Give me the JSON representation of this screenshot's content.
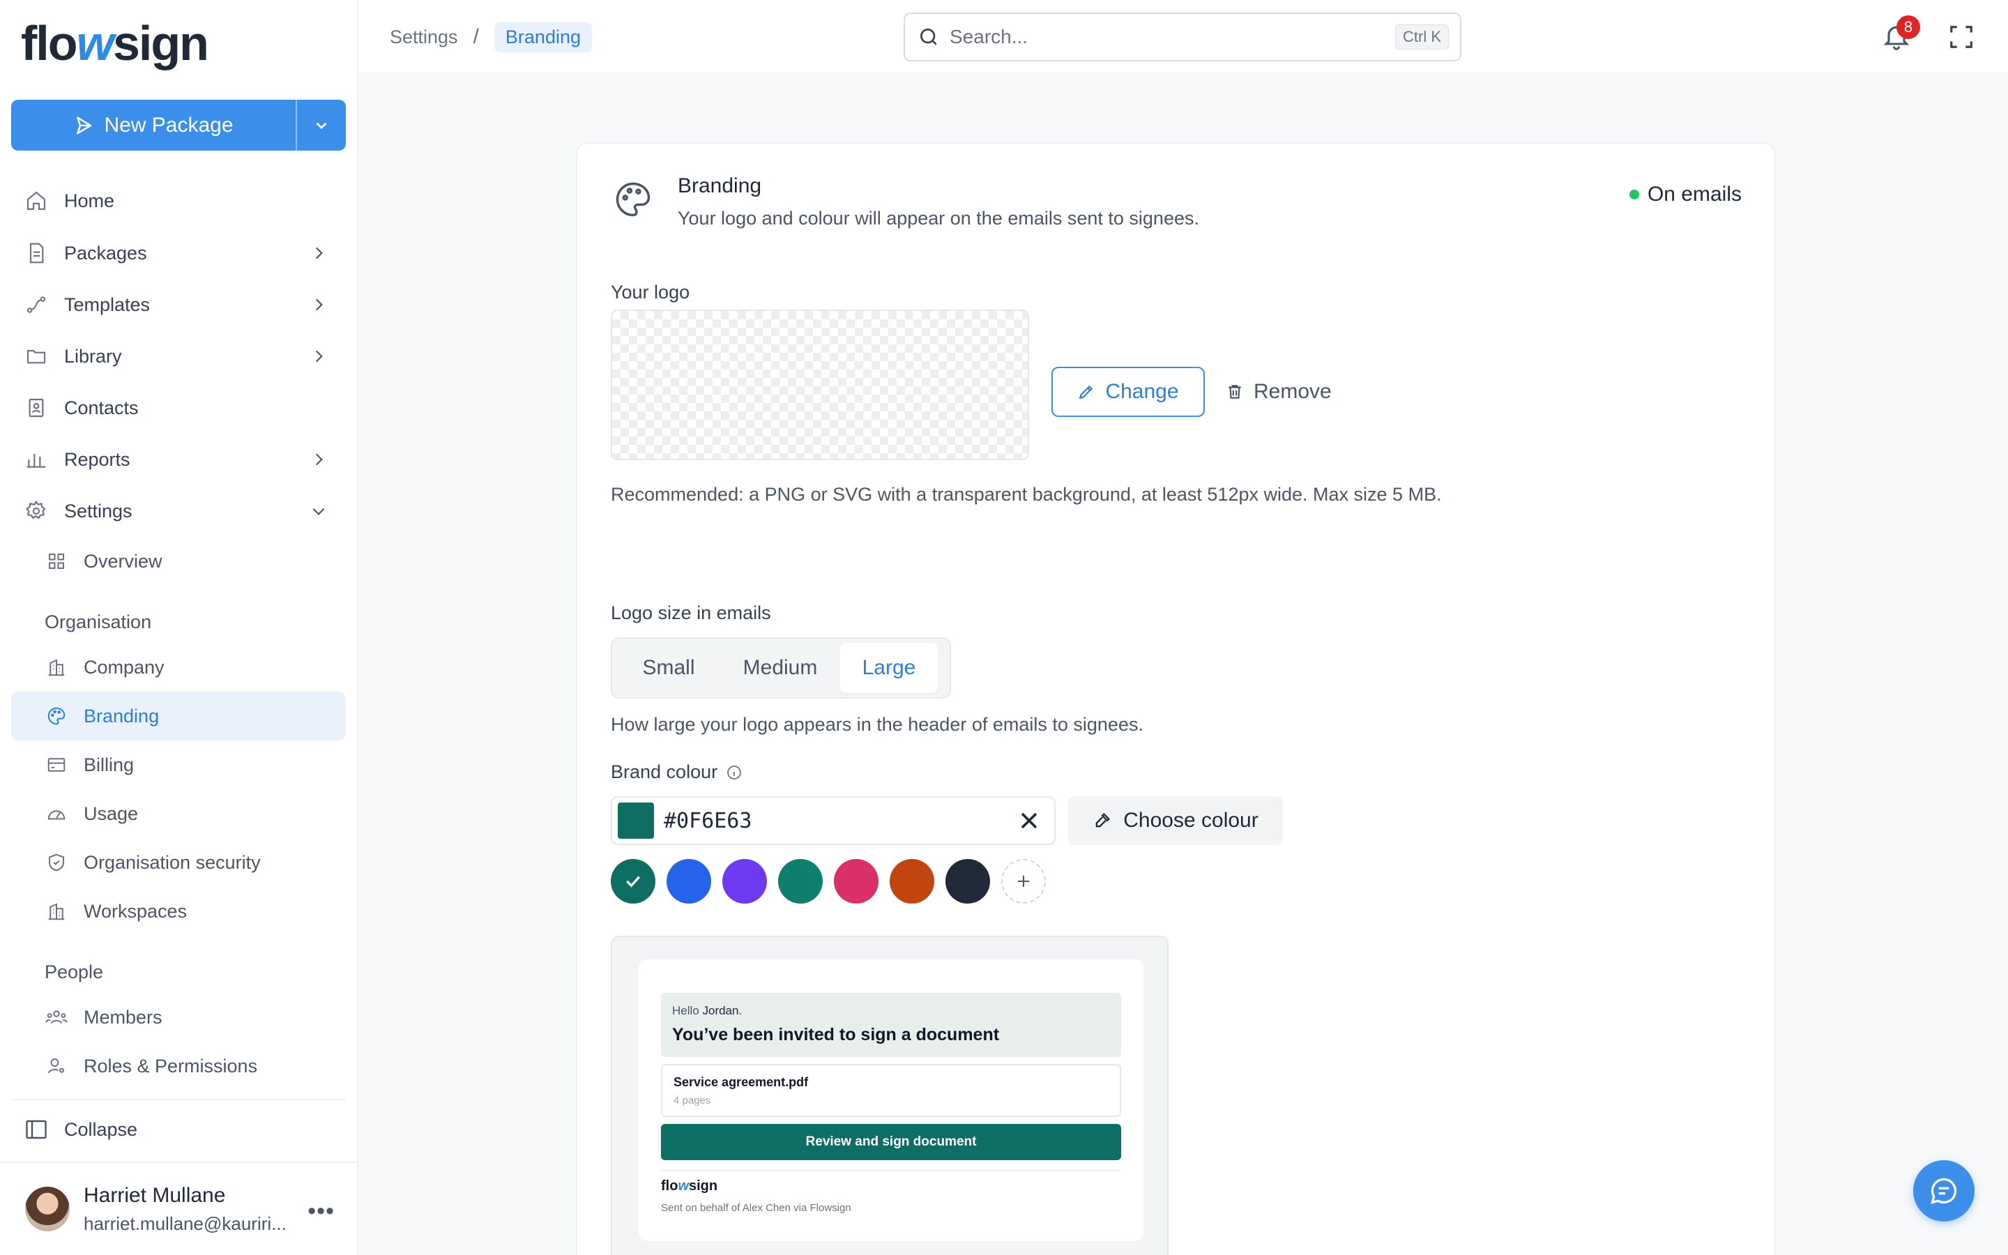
{
  "brand": {
    "logo_part1": "flo",
    "logo_accent": "w",
    "logo_part2": "sign"
  },
  "sidebar": {
    "new_package_label": "New Package",
    "nav": [
      {
        "label": "Home",
        "icon": "home-icon"
      },
      {
        "label": "Packages",
        "icon": "document-icon"
      },
      {
        "label": "Templates",
        "icon": "route-icon"
      },
      {
        "label": "Library",
        "icon": "folder-icon"
      },
      {
        "label": "Contacts",
        "icon": "contact-book-icon"
      },
      {
        "label": "Reports",
        "icon": "bar-chart-icon"
      },
      {
        "label": "Settings",
        "icon": "gear-icon"
      }
    ],
    "settings_sub": {
      "overview": "Overview"
    },
    "organisation": {
      "label": "Organisation",
      "items": [
        "Company",
        "Branding",
        "Billing",
        "Usage",
        "Organisation security",
        "Workspaces"
      ]
    },
    "people": {
      "label": "People",
      "items": [
        "Members",
        "Roles & Permissions"
      ]
    },
    "collapse_label": "Collapse",
    "user": {
      "name": "Harriet Mullane",
      "email": "harriet.mullane@kauriri..."
    }
  },
  "topbar": {
    "breadcrumb": [
      "Settings",
      "Branding"
    ],
    "search_placeholder": "Search...",
    "search_shortcut": "Ctrl K",
    "notification_count": "8"
  },
  "branding": {
    "title": "Branding",
    "subtitle": "Your logo and colour will appear on the emails sent to signees.",
    "status": "On emails",
    "logo_label": "Your logo",
    "change_label": "Change",
    "remove_label": "Remove",
    "logo_hint": "Recommended: a PNG or SVG with a transparent background, at least 512px wide. Max size 5 MB.",
    "size_label": "Logo size in emails",
    "size_options": [
      "Small",
      "Medium",
      "Large"
    ],
    "size_selected": "Large",
    "size_hint": "How large your logo appears in the header of emails to signees.",
    "colour_label": "Brand colour",
    "colour_value": "#0F6E63",
    "choose_colour_label": "Choose colour",
    "swatches": [
      "#0F6E63",
      "#2563EB",
      "#6D3AF2",
      "#0E7F6C",
      "#DB2F6A",
      "#C2440E",
      "#1F2937"
    ]
  },
  "preview": {
    "hello": "Hello",
    "hello_name": "Jordan.",
    "title": "You’ve been invited to sign a document",
    "file_name": "Service agreement.pdf",
    "file_pages": "4 pages",
    "button": "Review and sign document",
    "logo_part1": "flo",
    "logo_accent": "w",
    "logo_part2": "sign",
    "sent_by": "Sent on behalf of Alex Chen via Flowsign"
  }
}
